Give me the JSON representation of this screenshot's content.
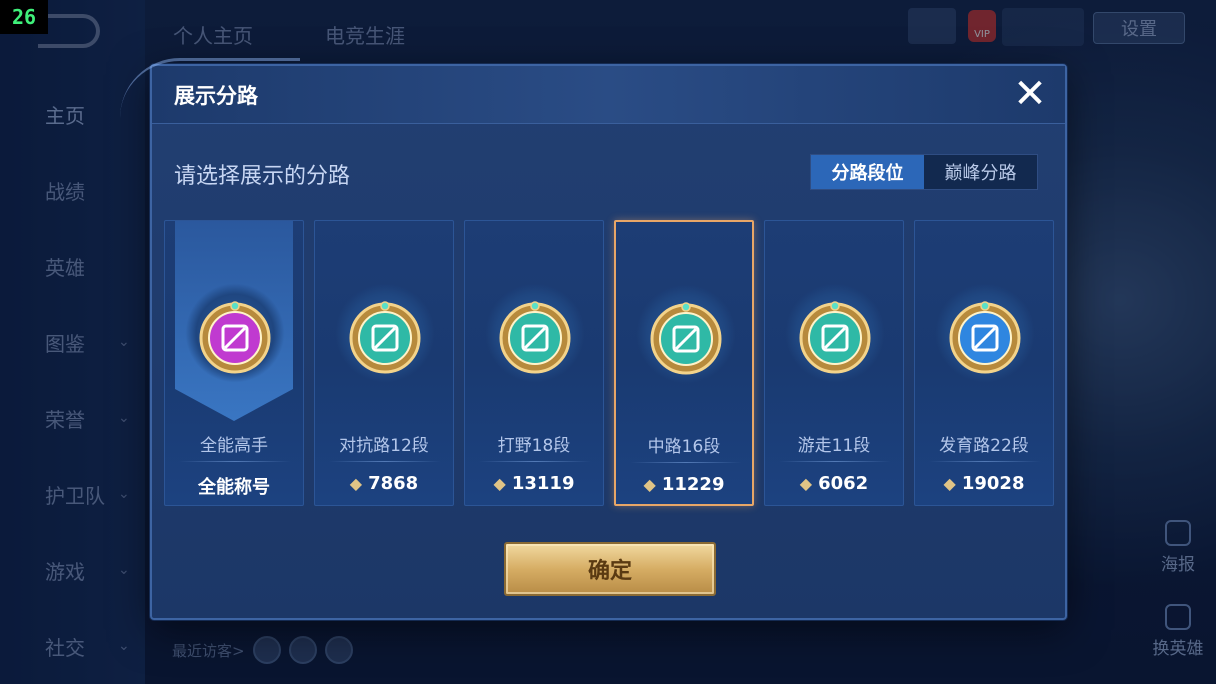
{
  "fps": "26",
  "sidebar": {
    "items": [
      {
        "label": "主页",
        "chevron": false
      },
      {
        "label": "战绩",
        "chevron": false
      },
      {
        "label": "英雄",
        "chevron": false
      },
      {
        "label": "图鉴",
        "chevron": true
      },
      {
        "label": "荣誉",
        "chevron": true
      },
      {
        "label": "护卫队",
        "chevron": true
      },
      {
        "label": "游戏",
        "chevron": true
      },
      {
        "label": "社交",
        "chevron": true
      }
    ]
  },
  "topbar": {
    "tabs": [
      "个人主页",
      "电竞生涯"
    ],
    "settings_label": "设置",
    "vip_label": "VIP"
  },
  "bottom": {
    "recent_visitors_label": "最近访客>"
  },
  "right_panel": {
    "poster_label": "海报",
    "swap_hero_label": "换英雄"
  },
  "modal": {
    "title": "展示分路",
    "subtitle": "请选择展示的分路",
    "toggle": {
      "active": "分路段位",
      "inactive": "巅峰分路"
    },
    "confirm_label": "确定",
    "cards": [
      {
        "name": "全能高手",
        "value": "全能称号",
        "show_points_icon": false,
        "emblem": "all-round-emblem",
        "color": "#c03ad0",
        "selected": false
      },
      {
        "name": "对抗路12段",
        "value": "7868",
        "show_points_icon": true,
        "emblem": "clash-lane-emblem",
        "color": "#2fb9a6",
        "selected": false
      },
      {
        "name": "打野18段",
        "value": "13119",
        "show_points_icon": true,
        "emblem": "jungle-emblem",
        "color": "#2fb9a6",
        "selected": false
      },
      {
        "name": "中路16段",
        "value": "11229",
        "show_points_icon": true,
        "emblem": "mid-lane-emblem",
        "color": "#2fb9a6",
        "selected": true
      },
      {
        "name": "游走11段",
        "value": "6062",
        "show_points_icon": true,
        "emblem": "roam-emblem",
        "color": "#2fb9a6",
        "selected": false
      },
      {
        "name": "发育路22段",
        "value": "19028",
        "show_points_icon": true,
        "emblem": "farm-lane-emblem",
        "color": "#2f86e0",
        "selected": false
      }
    ]
  }
}
